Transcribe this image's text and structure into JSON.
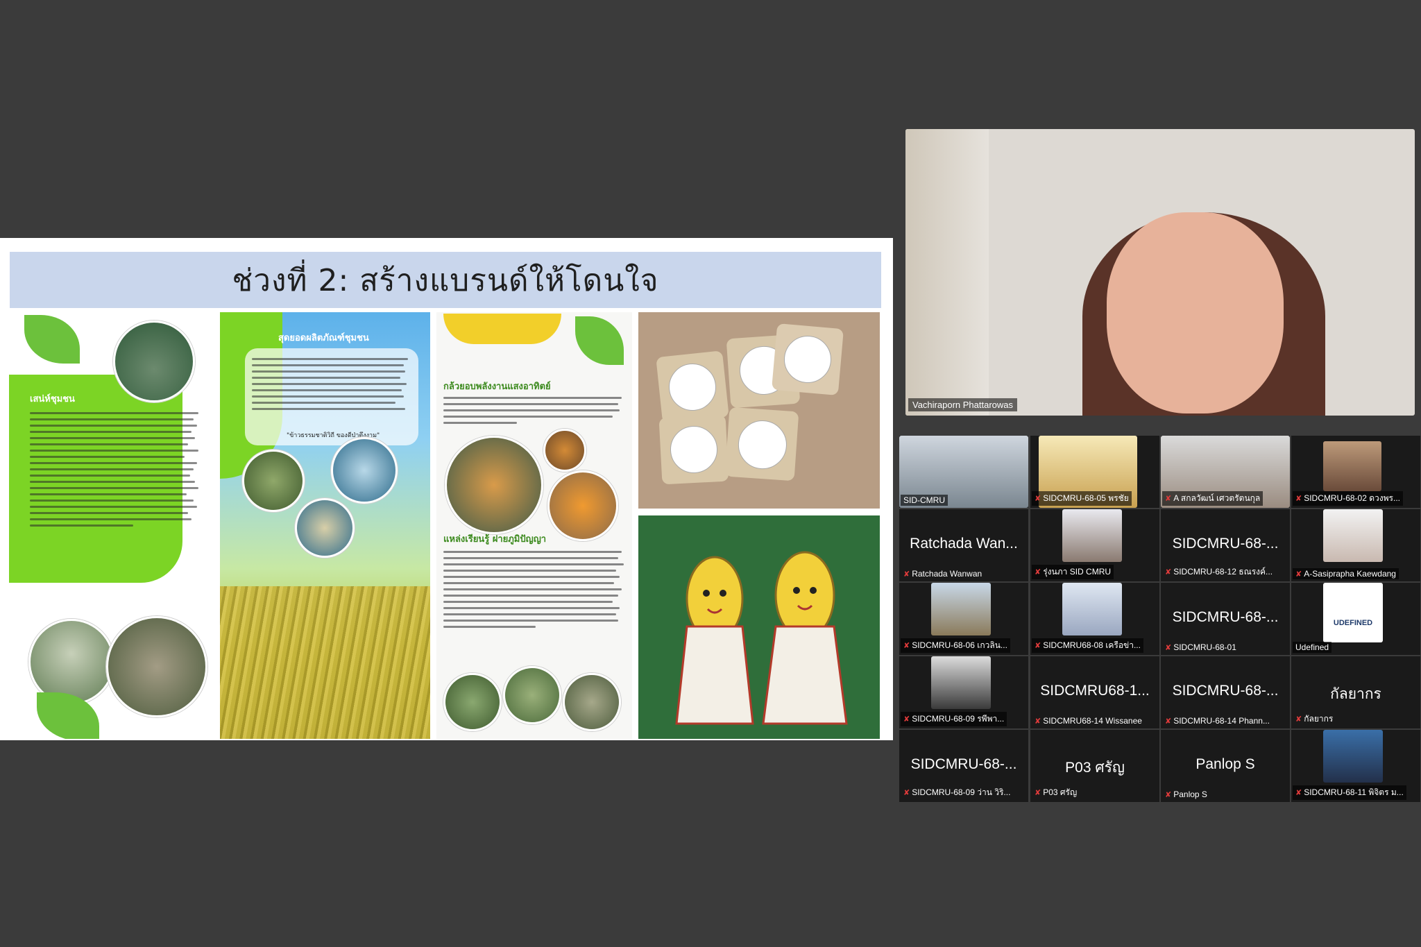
{
  "slide": {
    "title": "ช่วงที่ 2: สร้างแบรนด์ให้โดนใจ",
    "panel_1": {
      "heading": "เสน่ห์ชุมชน"
    },
    "panel_2": {
      "heading": "สุดยอดผลิตภัณฑ์ชุมชน",
      "quote": "\"ข้าวธรรมชาติวิถี ของดีป่าตึงงาม\""
    },
    "panel_3": {
      "heading_1": "กล้วยอบพลังงานแสงอาทิตย์",
      "heading_2": "แหล่งเรียนรู้ ฝายภูมิปัญญา"
    }
  },
  "speaker": {
    "name": "Vachiraporn Phattarowas"
  },
  "gallery": {
    "tiles": [
      {
        "label": "SID-CMRU",
        "big": "",
        "muted": false
      },
      {
        "label": "SIDCMRU-68-05  พรชัย",
        "big": "",
        "muted": true
      },
      {
        "label": "A สกลวัฒน์ เศวตรัตนกุล",
        "big": "",
        "muted": true
      },
      {
        "label": "SIDCMRU-68-02 ดวงพร...",
        "big": "",
        "muted": true
      },
      {
        "label": "Ratchada Wanwan",
        "big": "Ratchada Wan...",
        "muted": true
      },
      {
        "label": "รุ่งนภา SID CMRU",
        "big": "",
        "muted": true
      },
      {
        "label": "SIDCMRU-68-12 ธณรงค์...",
        "big": "SIDCMRU-68-...",
        "muted": true
      },
      {
        "label": "A-Sasiprapha Kaewdang",
        "big": "",
        "muted": true
      },
      {
        "label": "SIDCMRU-68-06 เกวลิน...",
        "big": "",
        "muted": true
      },
      {
        "label": "SIDCMRU68-08 เครือข่า...",
        "big": "",
        "muted": true
      },
      {
        "label": "SIDCMRU-68-01",
        "big": "SIDCMRU-68-...",
        "muted": true
      },
      {
        "label": "Udefined",
        "big": "",
        "muted": false
      },
      {
        "label": "SIDCMRU-68-09 รพีพา...",
        "big": "",
        "muted": true
      },
      {
        "label": "SIDCMRU68-14 Wissanee",
        "big": "SIDCMRU68-1...",
        "muted": true
      },
      {
        "label": "SIDCMRU-68-14 Phann...",
        "big": "SIDCMRU-68-...",
        "muted": true
      },
      {
        "label": "กัลยากร",
        "big": "กัลยากร",
        "muted": true
      },
      {
        "label": "SIDCMRU-68-09 ว่าน วิริ...",
        "big": "SIDCMRU-68-...",
        "muted": true
      },
      {
        "label": "P03 ศรัญ",
        "big": "P03 ศรัญ",
        "muted": true
      },
      {
        "label": "Panlop S",
        "big": "Panlop S",
        "muted": true
      },
      {
        "label": "SIDCMRU-68-11 พิจิตร ม...",
        "big": "",
        "muted": true
      }
    ],
    "udefined_logo": "UDEFINED"
  },
  "colors": {
    "background": "#3b3b3b",
    "title_bar": "#c9d6ec",
    "mic_off": "#e03b3b",
    "leaf_green": "#6cc13c"
  }
}
